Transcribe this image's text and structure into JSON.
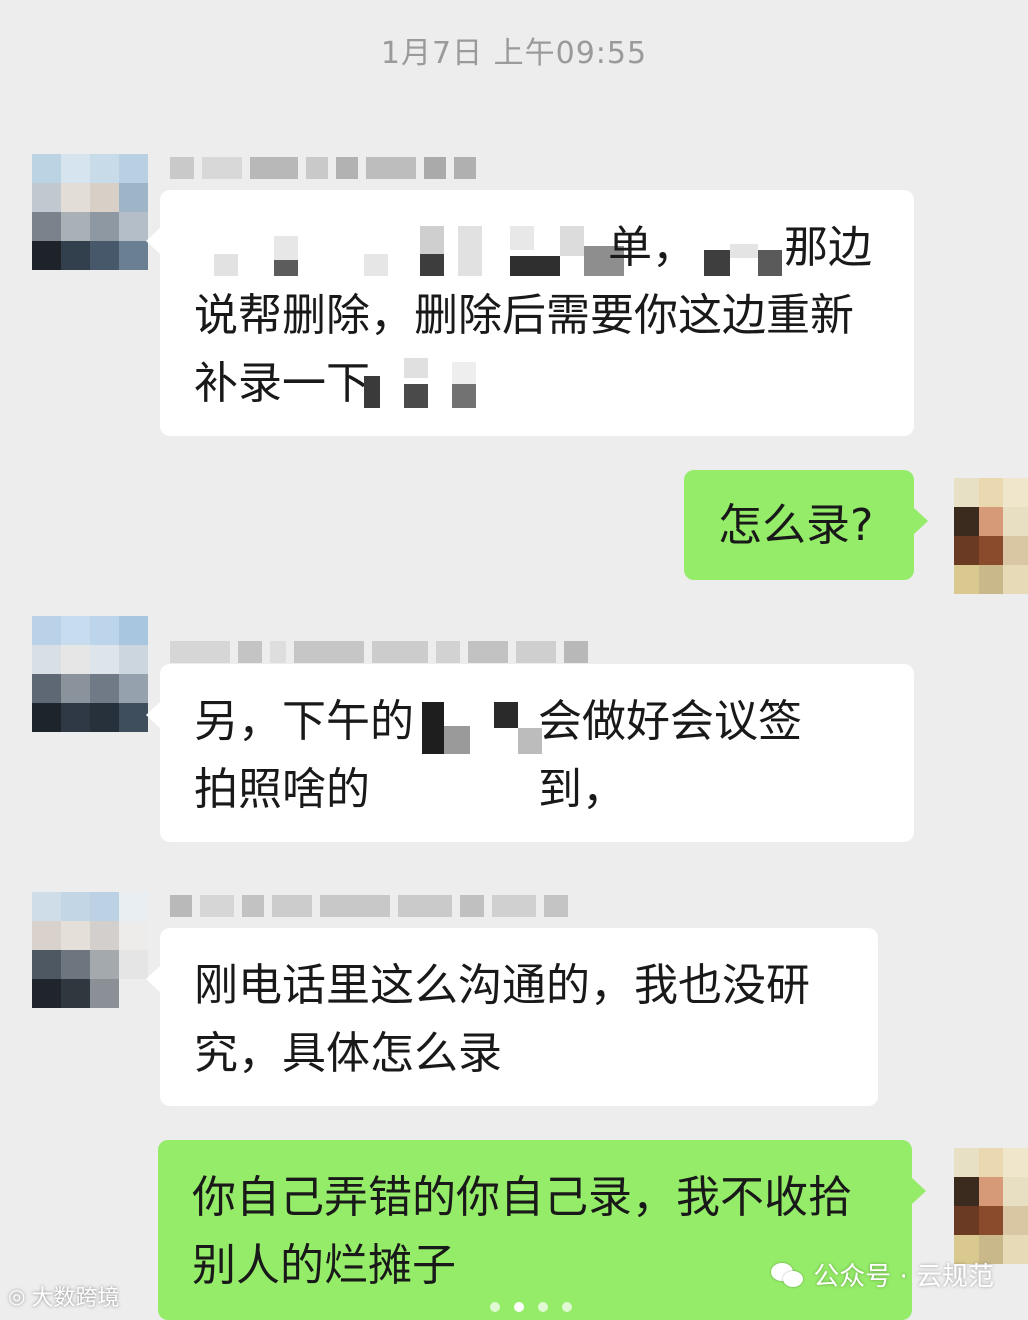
{
  "chat": {
    "timestamp": "1月7日 上午09:55",
    "messages": [
      {
        "side": "in",
        "line1_visible": "单，",
        "line1_tail": "那边",
        "line2": "说帮删除，删除后需要你这边重新",
        "line3": "补录一下"
      },
      {
        "side": "out",
        "text": "怎么录?"
      },
      {
        "side": "in",
        "line1_head": "另，下午的",
        "line1_tail": "会做好会议签到，",
        "line2": "拍照啥的"
      },
      {
        "side": "in",
        "line1": "刚电话里这么沟通的，我也没研",
        "line2": "究，具体怎么录"
      },
      {
        "side": "out",
        "line1": "你自己弄错的你自己录，我不收拾",
        "line2": "别人的烂摊子"
      }
    ]
  },
  "watermarks": {
    "left": "大数跨境",
    "right": "公众号 · 云规范"
  }
}
